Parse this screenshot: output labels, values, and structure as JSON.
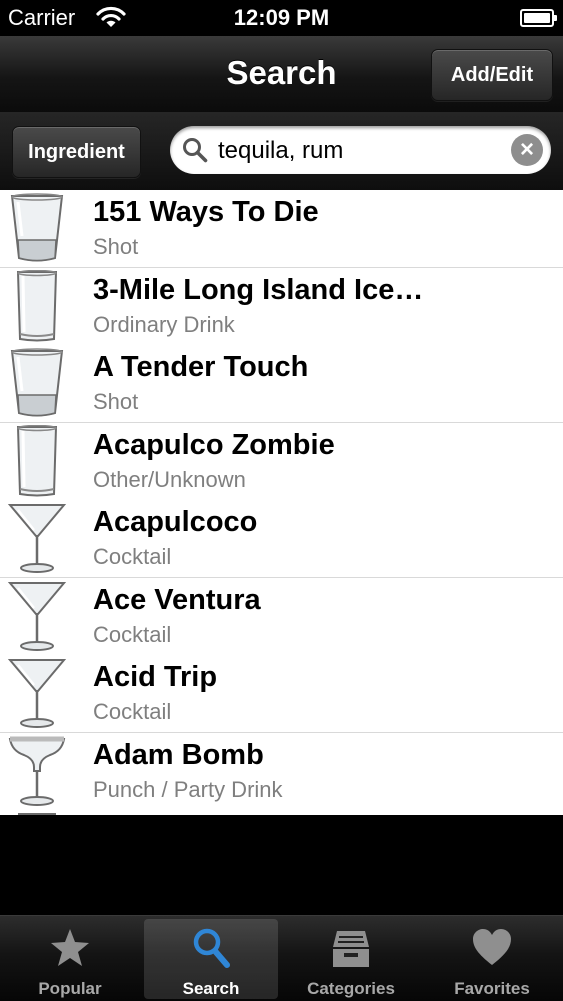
{
  "status": {
    "carrier": "Carrier",
    "time": "12:09 PM"
  },
  "nav": {
    "title": "Search",
    "right_button": "Add/Edit"
  },
  "search": {
    "scope_button": "Ingredient",
    "value": "tequila, rum"
  },
  "colors": {
    "accent": "#2f86d6",
    "subtitle": "#7f7f7f"
  },
  "drinks": [
    {
      "name": "151 Ways To Die",
      "category": "Shot",
      "glass": "shot-glass-icon"
    },
    {
      "name": "3-Mile Long Island Ice…",
      "category": "Ordinary Drink",
      "glass": "highball-glass-icon"
    },
    {
      "name": "A Tender Touch",
      "category": "Shot",
      "glass": "shot-glass-icon"
    },
    {
      "name": "Acapulco Zombie",
      "category": "Other/Unknown",
      "glass": "highball-glass-icon"
    },
    {
      "name": "Acapulcoco",
      "category": "Cocktail",
      "glass": "martini-glass-icon"
    },
    {
      "name": "Ace Ventura",
      "category": "Cocktail",
      "glass": "martini-glass-icon"
    },
    {
      "name": "Acid Trip",
      "category": "Cocktail",
      "glass": "martini-glass-icon"
    },
    {
      "name": "Adam Bomb",
      "category": "Punch / Party Drink",
      "glass": "margarita-glass-icon"
    }
  ],
  "tabs": [
    {
      "label": "Popular",
      "icon": "star-icon",
      "active": false
    },
    {
      "label": "Search",
      "icon": "search-icon",
      "active": true
    },
    {
      "label": "Categories",
      "icon": "cabinet-icon",
      "active": false
    },
    {
      "label": "Favorites",
      "icon": "heart-icon",
      "active": false
    }
  ]
}
